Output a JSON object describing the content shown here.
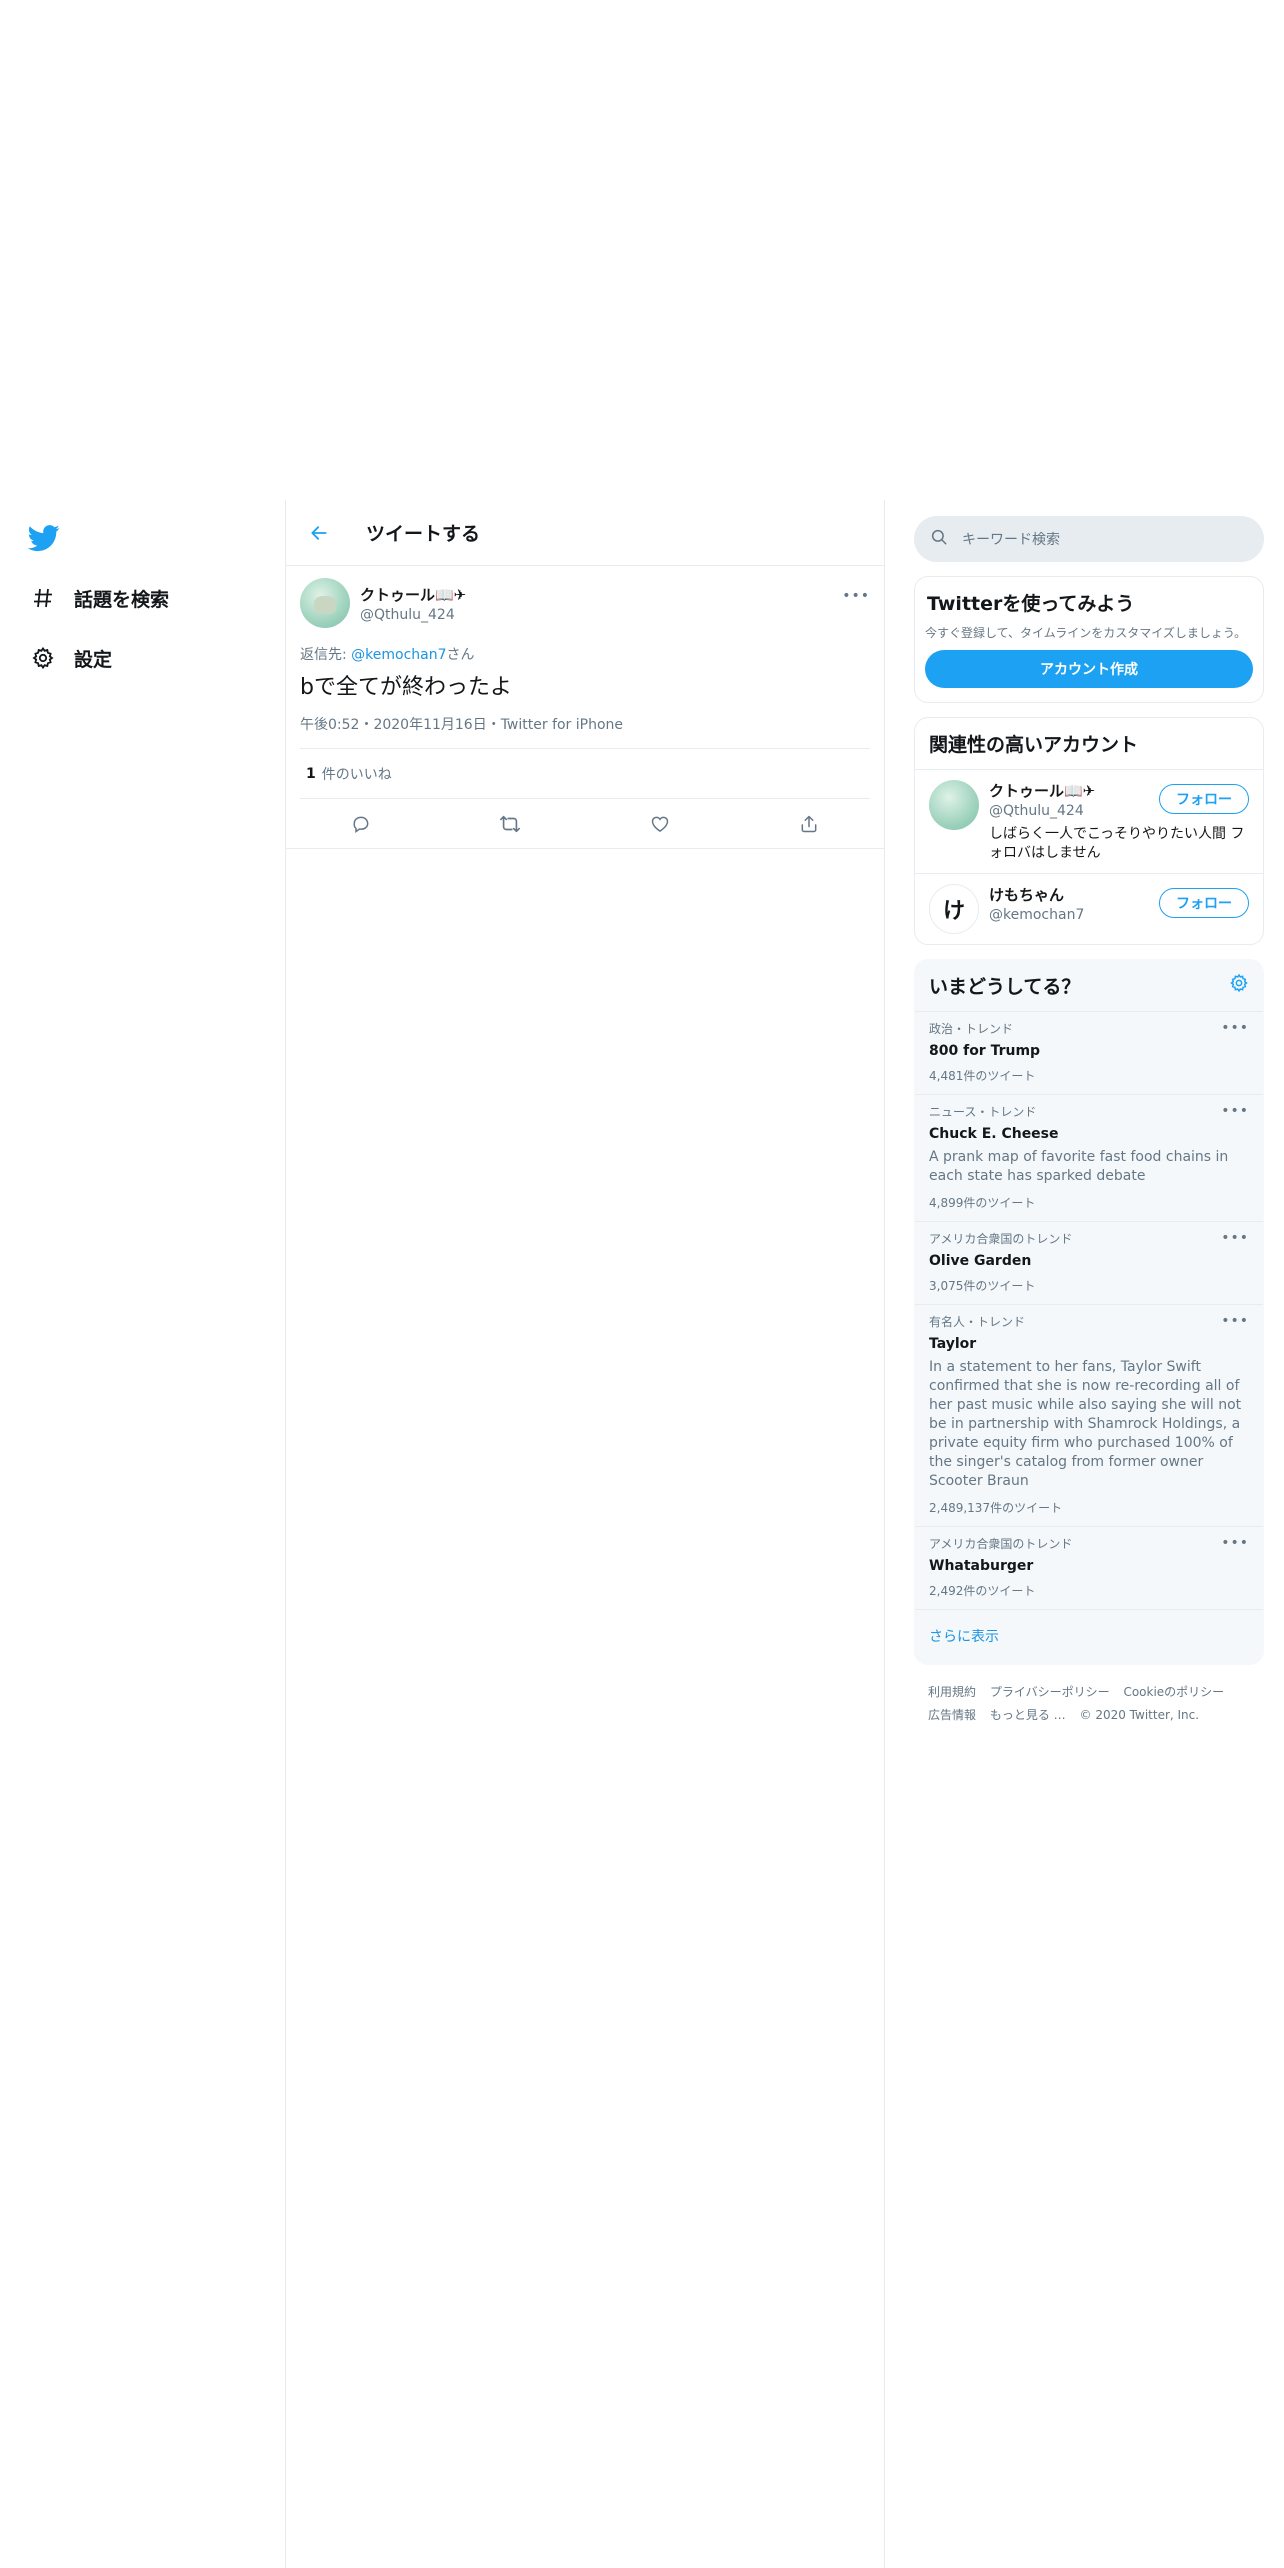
{
  "nav": {
    "items": [
      {
        "label": "話題を検索"
      },
      {
        "label": "設定"
      }
    ]
  },
  "header": {
    "title": "ツイートする"
  },
  "tweet": {
    "display_name": "クトゥール📖✈",
    "username": "@Qthulu_424",
    "more": "•••",
    "reply_prefix": "返信先: ",
    "reply_mention": "@kemochan7",
    "reply_suffix": "さん",
    "text": "bで全てが終わったよ",
    "meta": "午後0:52・2020年11月16日・Twitter for iPhone",
    "likes_count": "1",
    "likes_label": "件のいいね"
  },
  "search": {
    "placeholder": "キーワード検索"
  },
  "signup": {
    "title": "Twitterを使ってみよう",
    "description": "今すぐ登録して、タイムラインをカスタマイズしましょう。",
    "button": "アカウント作成"
  },
  "relevant": {
    "title": "関連性の高いアカウント",
    "accounts": [
      {
        "name": "クトゥール📖✈",
        "handle": "@Qthulu_424",
        "bio": "しばらく一人でこっそりやりたい人間 フォロバはしません",
        "button": "フォロー"
      },
      {
        "name": "けもちゃん",
        "handle": "@kemochan7",
        "avatar_letter": "け",
        "button": "フォロー"
      }
    ]
  },
  "trends": {
    "title": "いまどうしてる？",
    "items": [
      {
        "context": "政治・トレンド",
        "name": "800 for Trump",
        "count": "4,481件のツイート"
      },
      {
        "context": "ニュース・トレンド",
        "name": "Chuck E. Cheese",
        "description": "A prank map of favorite fast food chains in each state has sparked debate",
        "count": "4,899件のツイート"
      },
      {
        "context": "アメリカ合衆国のトレンド",
        "name": "Olive Garden",
        "count": "3,075件のツイート"
      },
      {
        "context": "有名人・トレンド",
        "name": "Taylor",
        "description": "In a statement to her fans, Taylor Swift confirmed that she is now re-recording all of her past music while also saying she will not be in partnership with Shamrock Holdings, a private equity firm who purchased 100% of the singer's catalog from former owner Scooter Braun",
        "count": "2,489,137件のツイート"
      },
      {
        "context": "アメリカ合衆国のトレンド",
        "name": "Whataburger",
        "count": "2,492件のツイート"
      }
    ],
    "show_more": "さらに表示"
  },
  "footer": {
    "links": [
      "利用規約",
      "プライバシーポリシー",
      "Cookieのポリシー",
      "広告情報",
      "もっと見る …",
      "© 2020 Twitter, Inc."
    ]
  },
  "colors": {
    "brand": "#1da1f2",
    "link": "#1b95e0",
    "muted": "#657786"
  }
}
